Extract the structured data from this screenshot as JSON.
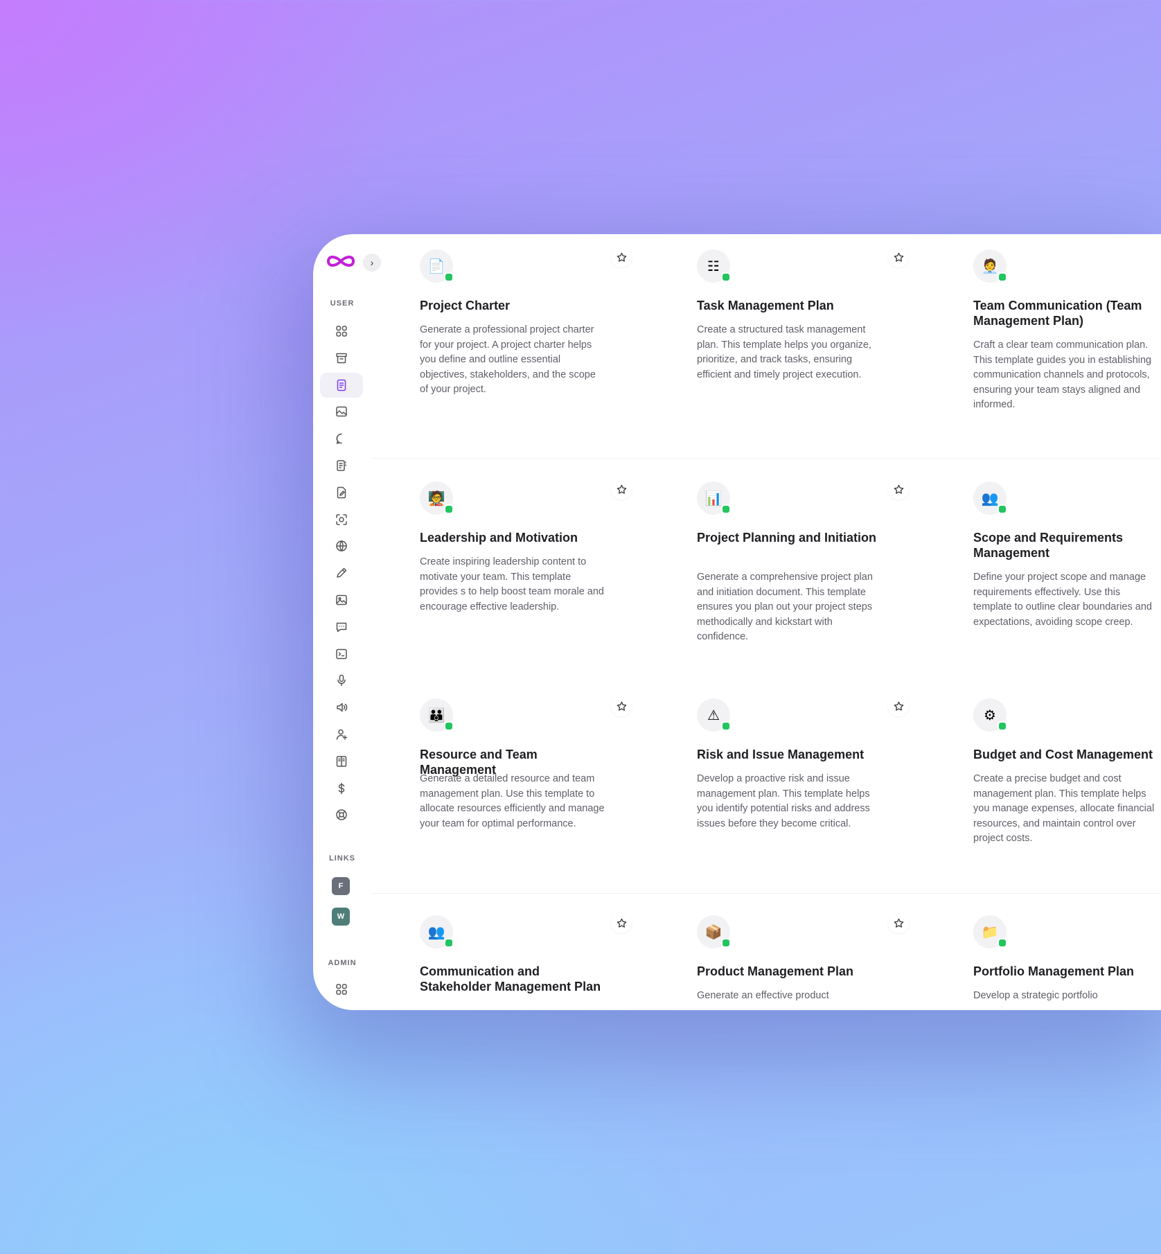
{
  "sidebar": {
    "user_label": "USER",
    "links_label": "LINKS",
    "admin_label": "ADMIN",
    "links": [
      {
        "letter": "F",
        "color": "#6b6f7a"
      },
      {
        "letter": "W",
        "color": "#4f7e78"
      }
    ],
    "nav_icons": [
      "grid-icon",
      "archive-icon",
      "document-icon",
      "image-icon",
      "chat-bubble-icon",
      "list-document-icon",
      "file-edit-icon",
      "scan-face-icon",
      "www-globe-icon",
      "pen-icon",
      "picture-icon",
      "message-square-icon",
      "terminal-icon",
      "microphone-icon",
      "speaker-icon",
      "user-plus-icon",
      "columns-icon",
      "dollar-icon",
      "lifebuoy-icon"
    ],
    "active_index": 2
  },
  "cards": [
    {
      "title": "Project Charter",
      "desc": "Generate a professional project charter for your project. A project charter helps you define and outline essential objectives, stakeholders, and the scope of your project.",
      "icon": "📄",
      "starred": true
    },
    {
      "title": "Task Management Plan",
      "desc": "Create a structured task management plan. This template helps you organize, prioritize, and track tasks, ensuring efficient and timely project execution.",
      "icon": "☷",
      "starred": true
    },
    {
      "title": "Team Communication (Team Management Plan)",
      "desc": "Craft a clear team communication plan. This template guides you in establishing communication channels and protocols, ensuring your team stays aligned and informed.",
      "icon": "🧑‍💼",
      "starred": false
    },
    {
      "title": "Leadership and Motivation",
      "desc": "Create inspiring leadership content to motivate your team. This template provides s to help boost team morale and encourage effective leadership.",
      "icon": "🧑‍🏫",
      "starred": true
    },
    {
      "title": "Project Planning and Initiation",
      "desc": "Generate a comprehensive project plan and initiation document. This template ensures you plan out your project steps methodically and kickstart with confidence.",
      "icon": "📊",
      "starred": true
    },
    {
      "title": "Scope and Requirements Management",
      "desc": "Define your project scope and manage requirements effectively. Use this template to outline clear boundaries and expectations, avoiding scope creep.",
      "icon": "👥",
      "starred": false
    },
    {
      "title": "Resource and Team Management",
      "desc": "Generate a detailed resource and team management plan. Use this template to allocate resources efficiently and manage your team for optimal performance.",
      "icon": "👪",
      "starred": true
    },
    {
      "title": "Risk and Issue Management",
      "desc": "Develop a proactive risk and issue management plan. This template helps you identify potential risks and address issues before they become critical.",
      "icon": "⚠",
      "starred": true
    },
    {
      "title": "Budget and Cost Management",
      "desc": "Create a precise budget and cost management plan. This template helps you manage expenses, allocate financial resources, and maintain control over project costs.",
      "icon": "⚙",
      "starred": false
    },
    {
      "title": "Communication and Stakeholder Management Plan",
      "desc": "",
      "icon": "👥",
      "starred": true
    },
    {
      "title": "Product Management Plan",
      "desc": "Generate an effective product",
      "icon": "📦",
      "starred": true
    },
    {
      "title": "Portfolio Management Plan",
      "desc": "Develop a strategic portfolio",
      "icon": "📁",
      "starred": false
    }
  ]
}
